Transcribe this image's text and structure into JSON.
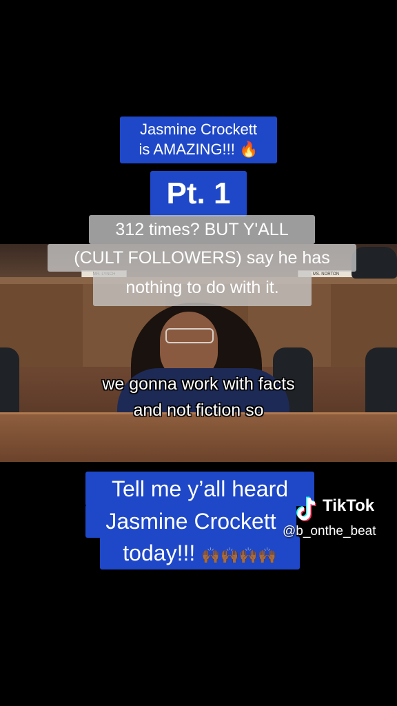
{
  "title_box": {
    "line1": "Jasmine Crockett",
    "line2": "is AMAZING!!!",
    "emoji": "🔥"
  },
  "part_label": "Pt. 1",
  "comment": {
    "line1": "312 times? BUT Y'ALL",
    "line2": "(CULT FOLLOWERS) say he has",
    "line3": "nothing to do with it."
  },
  "video": {
    "nameplates": [
      "MR. LYNCH",
      "MS. NORTON"
    ],
    "subtitle_line1": "we gonna work with facts",
    "subtitle_line2": "and not fiction so"
  },
  "bottom_box": {
    "line1": "Tell me y’all heard",
    "line2": "Jasmine Crockett",
    "line3": "today!!!",
    "emoji": "🙌🏾🙌🏾🙌🏾🙌🏾"
  },
  "watermark": {
    "brand": "TikTok",
    "handle": "@b_onthe_beat"
  },
  "colors": {
    "box_blue": "#1f48c8",
    "background": "#000000"
  }
}
